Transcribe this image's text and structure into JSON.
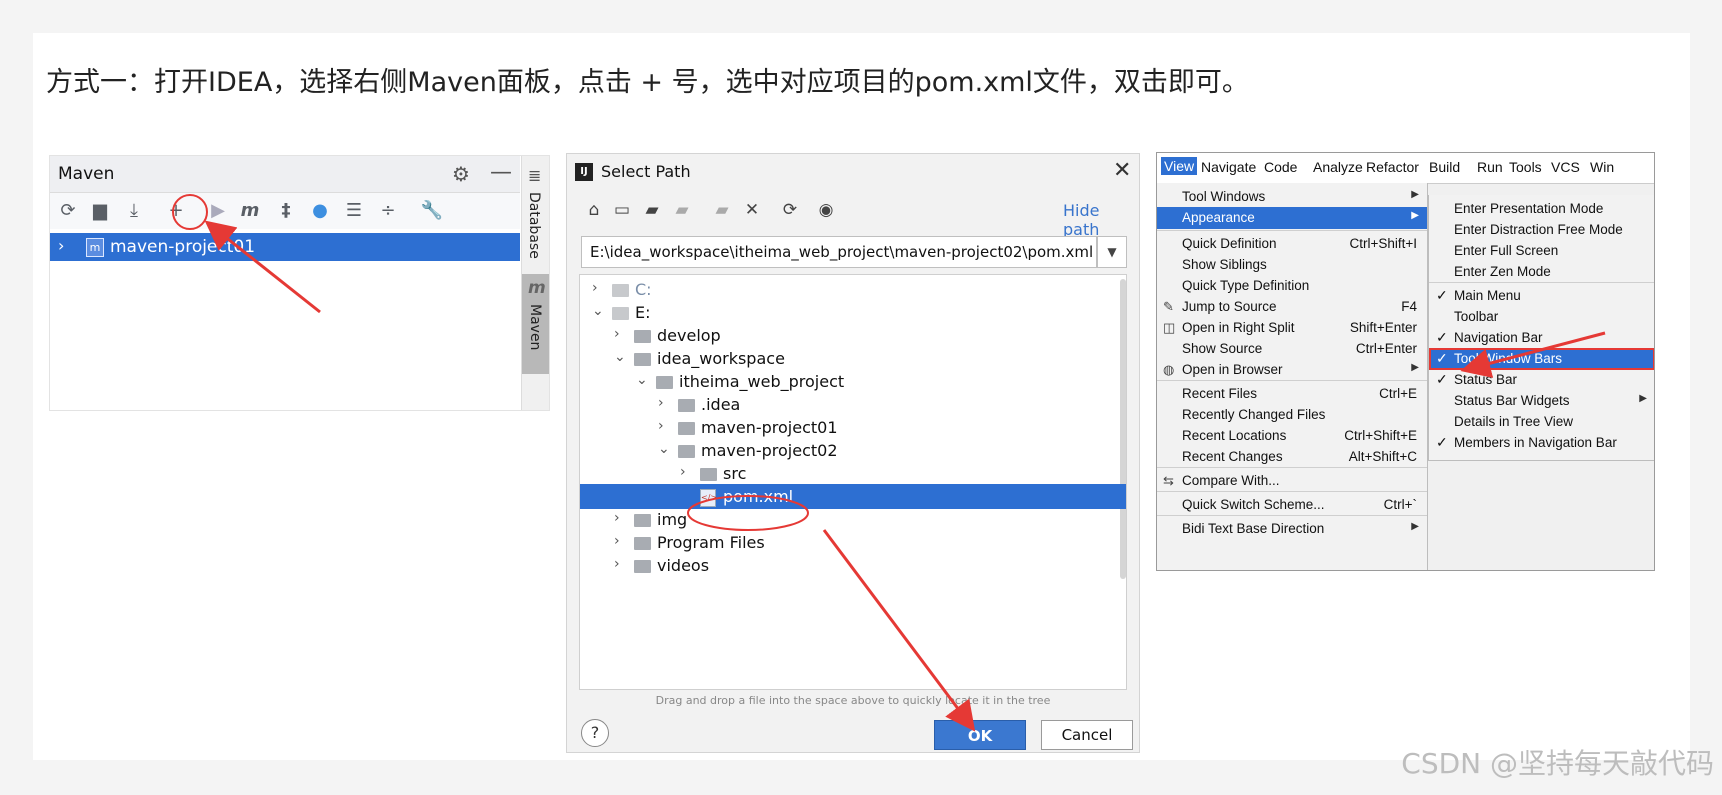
{
  "heading": "方式一：打开IDEA，选择右侧Maven面板，点击 + 号，选中对应项目的pom.xml文件，双击即可。",
  "watermark": "CSDN @坚持每天敲代码",
  "maven_panel": {
    "title": "Maven",
    "project_row": "maven-project01",
    "side_tabs": [
      "Database",
      "Maven"
    ]
  },
  "select_path": {
    "title": "Select Path",
    "hide_path": "Hide path",
    "path_value": "E:\\idea_workspace\\itheima_web_project\\maven-project02\\pom.xml",
    "tree": [
      {
        "name": "C:",
        "depth": 0,
        "expanded": false,
        "drive": true
      },
      {
        "name": "E:",
        "depth": 0,
        "expanded": true,
        "drive": true
      },
      {
        "name": "develop",
        "depth": 1,
        "expanded": false
      },
      {
        "name": "idea_workspace",
        "depth": 1,
        "expanded": true
      },
      {
        "name": "itheima_web_project",
        "depth": 2,
        "expanded": true
      },
      {
        "name": ".idea",
        "depth": 3,
        "expanded": false
      },
      {
        "name": "maven-project01",
        "depth": 3,
        "expanded": false
      },
      {
        "name": "maven-project02",
        "depth": 3,
        "expanded": true
      },
      {
        "name": "src",
        "depth": 4,
        "expanded": false
      },
      {
        "name": "pom.xml",
        "depth": 4,
        "file": true,
        "selected": true
      },
      {
        "name": "img",
        "depth": 1,
        "expanded": false
      },
      {
        "name": "Program Files",
        "depth": 1,
        "expanded": false
      },
      {
        "name": "videos",
        "depth": 1,
        "expanded": false
      }
    ],
    "hint": "Drag and drop a file into the space above to quickly locate it in the tree",
    "help": "?",
    "ok": "OK",
    "cancel": "Cancel"
  },
  "view_menu": {
    "menubar": [
      "View",
      "Navigate",
      "Code",
      "Analyze",
      "Refactor",
      "Build",
      "Run",
      "Tools",
      "VCS",
      "Win"
    ],
    "items": [
      {
        "label": "Tool Windows",
        "arrow": true
      },
      {
        "label": "Appearance",
        "arrow": true,
        "highlighted": true
      },
      {
        "label": "Quick Definition",
        "shortcut": "Ctrl+Shift+I"
      },
      {
        "label": "Show Siblings"
      },
      {
        "label": "Quick Type Definition"
      },
      {
        "label": "Jump to Source",
        "shortcut": "F4",
        "icon": "jump-icon"
      },
      {
        "label": "Open in Right Split",
        "shortcut": "Shift+Enter",
        "icon": "split-icon"
      },
      {
        "label": "Show Source",
        "shortcut": "Ctrl+Enter"
      },
      {
        "label": "Open in Browser",
        "arrow": true,
        "icon": "browser-icon"
      },
      {
        "label": "Recent Files",
        "shortcut": "Ctrl+E"
      },
      {
        "label": "Recently Changed Files"
      },
      {
        "label": "Recent Locations",
        "shortcut": "Ctrl+Shift+E"
      },
      {
        "label": "Recent Changes",
        "shortcut": "Alt+Shift+C"
      },
      {
        "label": "Compare With...",
        "icon": "compare-icon"
      },
      {
        "label": "Quick Switch Scheme...",
        "shortcut": "Ctrl+`"
      },
      {
        "label": "Bidi Text Base Direction",
        "arrow": true
      }
    ],
    "submenu": [
      {
        "label": "Enter Presentation Mode"
      },
      {
        "label": "Enter Distraction Free Mode"
      },
      {
        "label": "Enter Full Screen"
      },
      {
        "label": "Enter Zen Mode"
      },
      {
        "label": "Main Menu",
        "checked": true
      },
      {
        "label": "Toolbar"
      },
      {
        "label": "Navigation Bar",
        "checked": true
      },
      {
        "label": "Tool Window Bars",
        "checked": true,
        "highlighted": true
      },
      {
        "label": "Status Bar",
        "checked": true
      },
      {
        "label": "Status Bar Widgets",
        "arrow": true
      },
      {
        "label": "Details in Tree View"
      },
      {
        "label": "Members in Navigation Bar",
        "checked": true
      }
    ]
  },
  "colors": {
    "accent": "#2d6fd2",
    "annotation": "#e53935"
  }
}
